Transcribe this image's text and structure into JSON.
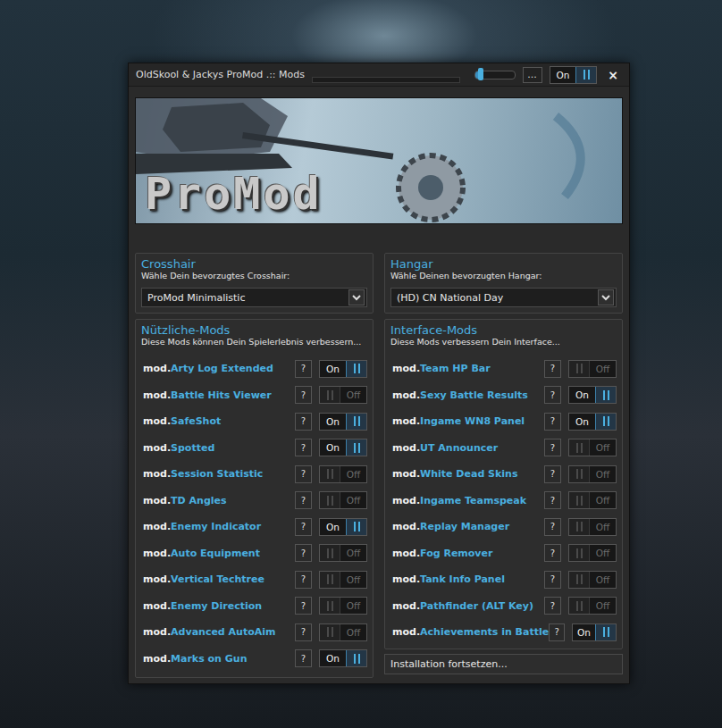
{
  "window": {
    "title": "OldSkool & Jackys ProMod .:: Mods",
    "progress": {
      "level": 0
    },
    "volume": {
      "level": 0.15
    },
    "menu_button": "...",
    "power": {
      "label": "On",
      "on": true
    },
    "close": "×"
  },
  "banner": {
    "logo": "ProMod"
  },
  "crosshair": {
    "title": "Crosshair",
    "subtitle": "Wähle Dein bevorzugtes Crosshair:",
    "value": "ProMod Minimalistic"
  },
  "hangar": {
    "title": "Hangar",
    "subtitle": "Wähle Deinen bevorzugten Hangar:",
    "value": "(HD) CN National Day"
  },
  "useful_mods": {
    "title": "Nützliche-Mods",
    "subtitle": "Diese Mods können Dein Spielerlebnis verbessern...",
    "items": [
      {
        "prefix": "mod.",
        "name": "Arty Log Extended",
        "help": "?",
        "toggle": "On",
        "on": true
      },
      {
        "prefix": "mod.",
        "name": "Battle Hits Viewer",
        "help": "?",
        "toggle": "Off",
        "on": false
      },
      {
        "prefix": "mod.",
        "name": "SafeShot",
        "help": "?",
        "toggle": "On",
        "on": true
      },
      {
        "prefix": "mod.",
        "name": "Spotted",
        "help": "?",
        "toggle": "On",
        "on": true
      },
      {
        "prefix": "mod.",
        "name": "Session Statistic",
        "help": "?",
        "toggle": "Off",
        "on": false
      },
      {
        "prefix": "mod.",
        "name": "TD Angles",
        "help": "?",
        "toggle": "Off",
        "on": false
      },
      {
        "prefix": "mod.",
        "name": "Enemy Indicator",
        "help": "?",
        "toggle": "On",
        "on": true
      },
      {
        "prefix": "mod.",
        "name": "Auto Equipment",
        "help": "?",
        "toggle": "Off",
        "on": false
      },
      {
        "prefix": "mod.",
        "name": "Vertical Techtree",
        "help": "?",
        "toggle": "Off",
        "on": false
      },
      {
        "prefix": "mod.",
        "name": "Enemy Direction",
        "help": "?",
        "toggle": "Off",
        "on": false
      },
      {
        "prefix": "mod.",
        "name": "Advanced AutoAim",
        "help": "?",
        "toggle": "Off",
        "on": false
      },
      {
        "prefix": "mod.",
        "name": "Marks on Gun",
        "help": "?",
        "toggle": "On",
        "on": true
      }
    ]
  },
  "interface_mods": {
    "title": "Interface-Mods",
    "subtitle": "Diese Mods verbessern Dein Interface...",
    "items": [
      {
        "prefix": "mod.",
        "name": "Team HP Bar",
        "help": "?",
        "toggle": "Off",
        "on": false
      },
      {
        "prefix": "mod.",
        "name": "Sexy Battle Results",
        "help": "?",
        "toggle": "On",
        "on": true
      },
      {
        "prefix": "mod.",
        "name": "Ingame WN8 Panel",
        "help": "?",
        "toggle": "On",
        "on": true
      },
      {
        "prefix": "mod.",
        "name": "UT Announcer",
        "help": "?",
        "toggle": "Off",
        "on": false
      },
      {
        "prefix": "mod.",
        "name": "White Dead Skins",
        "help": "?",
        "toggle": "Off",
        "on": false
      },
      {
        "prefix": "mod.",
        "name": "Ingame Teamspeak",
        "help": "?",
        "toggle": "Off",
        "on": false
      },
      {
        "prefix": "mod.",
        "name": "Replay Manager",
        "help": "?",
        "toggle": "Off",
        "on": false
      },
      {
        "prefix": "mod.",
        "name": "Fog Remover",
        "help": "?",
        "toggle": "Off",
        "on": false
      },
      {
        "prefix": "mod.",
        "name": "Tank Info Panel",
        "help": "?",
        "toggle": "Off",
        "on": false
      },
      {
        "prefix": "mod.",
        "name": "Pathfinder (ALT Key)",
        "help": "?",
        "toggle": "Off",
        "on": false
      },
      {
        "prefix": "mod.",
        "name": "Achievements in Battle",
        "help": "?",
        "toggle": "On",
        "on": true
      }
    ]
  },
  "continue_button": "Installation fortsetzen..."
}
